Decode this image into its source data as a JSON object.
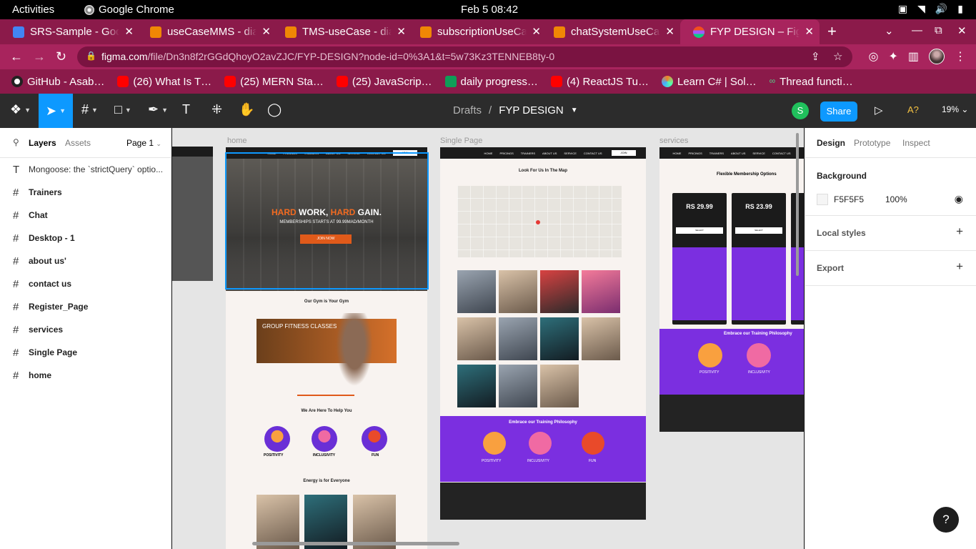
{
  "os_bar": {
    "activities": "Activities",
    "app_name": "Google Chrome",
    "clock": "Feb 5  08:42"
  },
  "tabs": [
    {
      "title": "SRS-Sample - Goog",
      "icon": "google-docs-icon"
    },
    {
      "title": "useCaseMMS - diag",
      "icon": "drawio-icon"
    },
    {
      "title": "TMS-useCase - diag",
      "icon": "drawio-icon"
    },
    {
      "title": "subscriptionUseCa",
      "icon": "drawio-icon"
    },
    {
      "title": "chatSystemUseCa",
      "icon": "drawio-icon"
    },
    {
      "title": "FYP DESIGN – Figm",
      "icon": "figma-icon",
      "active": true
    }
  ],
  "address": {
    "host": "figma.com",
    "path": "/file/Dn3n8f2rGGdQhoyO2avZJC/FYP-DESIGN?node-id=0%3A1&t=5w73Kz3TENNEB8ty-0"
  },
  "bookmarks": [
    {
      "label": "GitHub - Asab…",
      "icon": "github-icon"
    },
    {
      "label": "(26) What Is T…",
      "icon": "youtube-icon"
    },
    {
      "label": "(25) MERN Sta…",
      "icon": "youtube-icon"
    },
    {
      "label": "(25) JavaScrip…",
      "icon": "youtube-icon"
    },
    {
      "label": "daily progress…",
      "icon": "sheets-icon"
    },
    {
      "label": "(4) ReactJS Tu…",
      "icon": "youtube-icon"
    },
    {
      "label": "Learn C# | Sol…",
      "icon": "sololearn-icon"
    },
    {
      "label": "Thread functi…",
      "icon": "link-icon"
    }
  ],
  "figma": {
    "breadcrumb_parent": "Drafts",
    "breadcrumb_sep": "/",
    "file_name": "FYP DESIGN",
    "user_initial": "S",
    "share_label": "Share",
    "a11y_label": "A?",
    "zoom": "19%"
  },
  "left_panel": {
    "tab_layers": "Layers",
    "tab_assets": "Assets",
    "page_select": "Page 1",
    "layers": [
      {
        "name": "Mongoose: the `strictQuery` optio...",
        "type": "text"
      },
      {
        "name": "Trainers",
        "type": "frame"
      },
      {
        "name": "Chat",
        "type": "frame"
      },
      {
        "name": "Desktop - 1",
        "type": "frame"
      },
      {
        "name": "about us'",
        "type": "frame"
      },
      {
        "name": "contact us",
        "type": "frame"
      },
      {
        "name": "Register_Page",
        "type": "frame"
      },
      {
        "name": "services",
        "type": "frame"
      },
      {
        "name": "Single Page",
        "type": "frame"
      },
      {
        "name": "home",
        "type": "frame"
      }
    ]
  },
  "canvas": {
    "labels": {
      "home": "home",
      "single": "Single Page",
      "services": "services"
    },
    "home": {
      "hero_word1": "HARD",
      "hero_word2": " WORK, ",
      "hero_word3": "HARD",
      "hero_word4": " GAIN.",
      "hero_sub": "MEMBERSHIPS STARTS AT 99.99MAD/MONTH",
      "hero_cta": "JOIN NOW",
      "our_gym": "Our Gym is Your Gym",
      "group_fitness": "GROUP FITNESS CLASSES",
      "help": "We Are Here To Help You",
      "pillars": [
        "POSITIVITY",
        "INCLUSIVITY",
        "FUN"
      ],
      "energy": "Energy is for Everyone"
    },
    "single": {
      "map_title": "Look For Us In The Map",
      "philosophy": "Embrace our Training Philosophy",
      "pillars": [
        "POSITIVITY",
        "INCLUSIVITY",
        "FUN"
      ]
    },
    "services": {
      "title": "Flexible Membership Options",
      "prices": [
        "RS 29.99",
        "RS 23.99"
      ],
      "philosophy": "Embrace our Training Philosophy",
      "pillars": [
        "POSITIVITY",
        "INCLUSIVITY"
      ]
    }
  },
  "right_panel": {
    "tab_design": "Design",
    "tab_prototype": "Prototype",
    "tab_inspect": "Inspect",
    "background_title": "Background",
    "bg_hex": "F5F5F5",
    "bg_opacity": "100%",
    "local_styles": "Local styles",
    "export": "Export"
  },
  "help_label": "?"
}
